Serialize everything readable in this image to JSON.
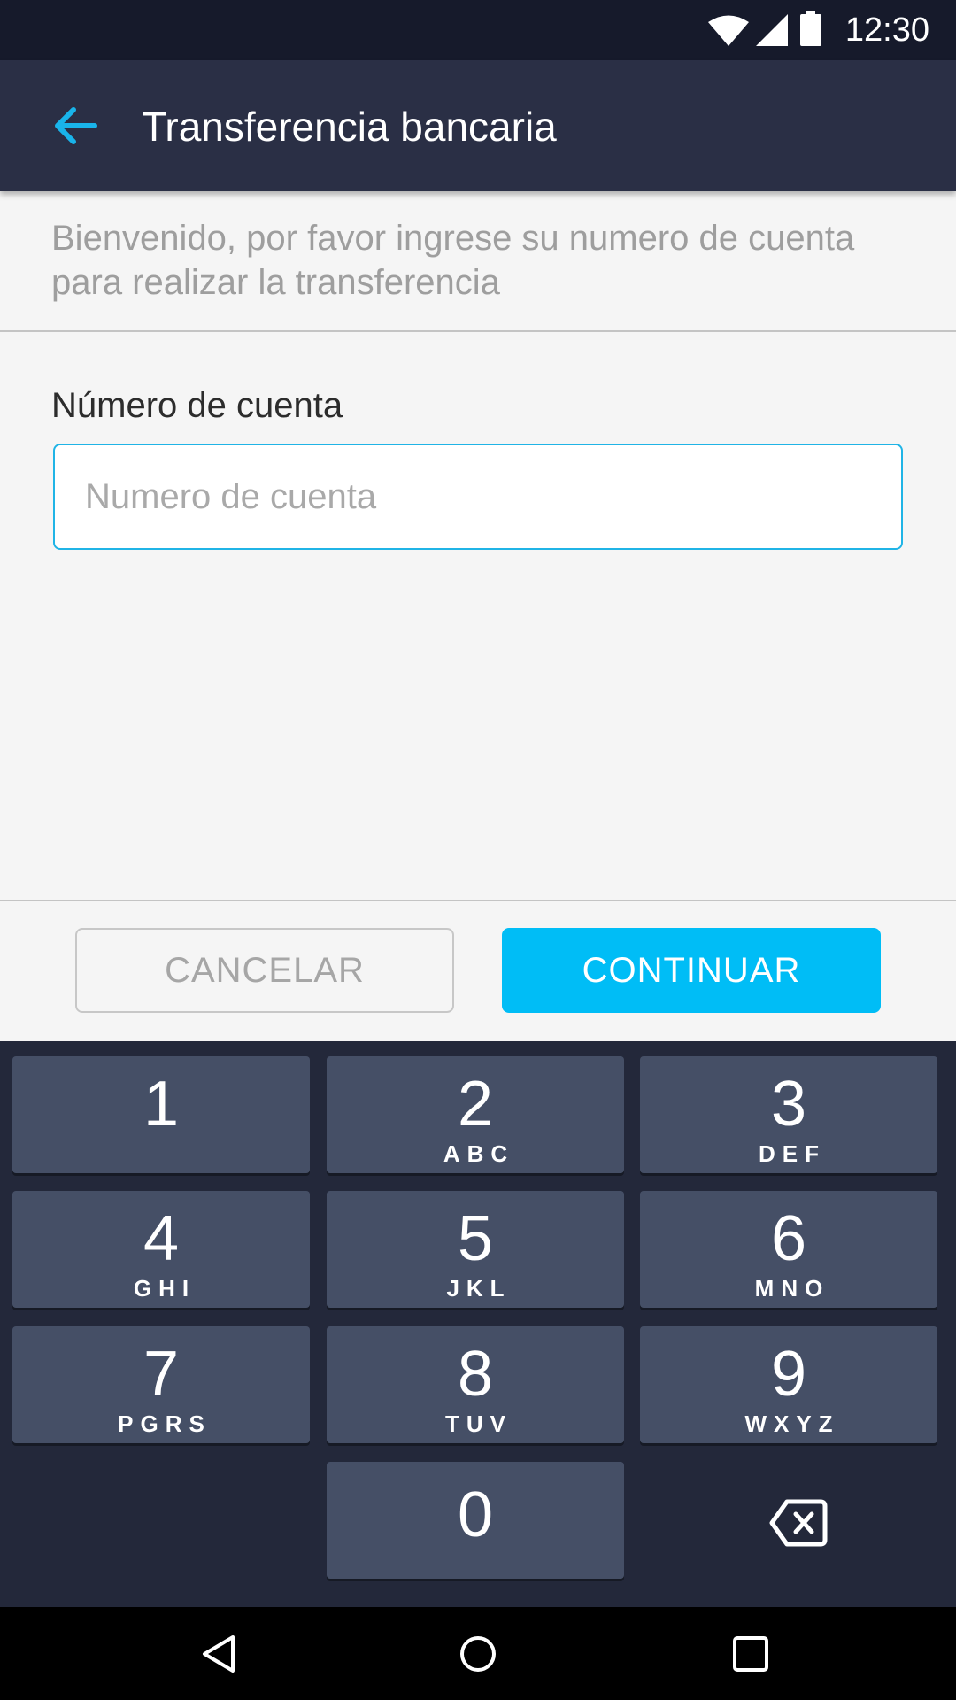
{
  "status_bar": {
    "time": "12:30",
    "icons": [
      "wifi-icon",
      "cellular-signal-icon",
      "battery-icon"
    ]
  },
  "app_bar": {
    "back_icon": "arrow-back-icon",
    "title": "Transferencia bancaria"
  },
  "intro_text": "Bienvenido, por favor ingrese su numero de cuenta para realizar la transferencia",
  "form": {
    "account_label": "Número de cuenta",
    "account_placeholder": "Numero de cuenta",
    "account_value": ""
  },
  "actions": {
    "cancel_label": "CANCELAR",
    "continue_label": "CONTINUAR"
  },
  "keypad": {
    "keys": [
      {
        "digit": "1",
        "letters": ""
      },
      {
        "digit": "2",
        "letters": "ABC"
      },
      {
        "digit": "3",
        "letters": "DEF"
      },
      {
        "digit": "4",
        "letters": "GHI"
      },
      {
        "digit": "5",
        "letters": "JKL"
      },
      {
        "digit": "6",
        "letters": "MNO"
      },
      {
        "digit": "7",
        "letters": "PGRS"
      },
      {
        "digit": "8",
        "letters": "TUV"
      },
      {
        "digit": "9",
        "letters": "WXYZ"
      },
      {
        "digit": "0",
        "letters": ""
      }
    ],
    "backspace_icon": "backspace-icon"
  },
  "nav_bar": {
    "icons": [
      "nav-back-icon",
      "nav-home-icon",
      "nav-recents-icon"
    ]
  },
  "colors": {
    "status_bar": "#161a2b",
    "app_bar": "#2a2f45",
    "accent": "#00bdf6",
    "keypad_bg": "#23283a",
    "key_bg": "#454f66"
  }
}
